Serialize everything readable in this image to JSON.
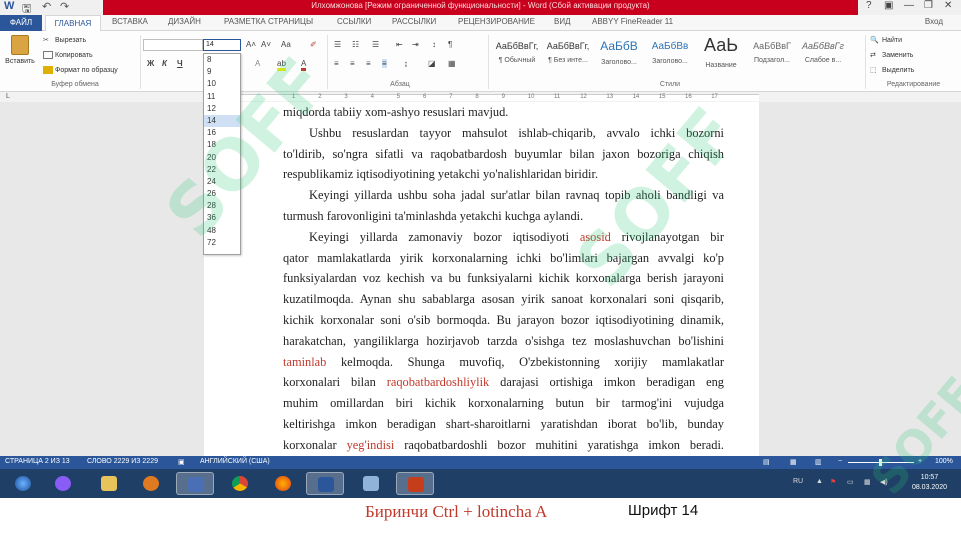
{
  "window": {
    "title": "Илхомжонова [Режим ограниченной функциональности] - Word (Сбой активации продукта)",
    "controls": [
      "?",
      "▣",
      "—",
      "❐",
      "✕"
    ]
  },
  "quick_access": {
    "save_icon": "save-icon",
    "undo_icon": "undo-icon",
    "redo_icon": "redo-icon"
  },
  "tabs": [
    {
      "label": "ФАЙЛ"
    },
    {
      "label": "ГЛАВНАЯ"
    },
    {
      "label": "ВСТАВКА"
    },
    {
      "label": "ДИЗАЙН"
    },
    {
      "label": "РАЗМЕТКА СТРАНИЦЫ"
    },
    {
      "label": "ССЫЛКИ"
    },
    {
      "label": "РАССЫЛКИ"
    },
    {
      "label": "РЕЦЕНЗИРОВАНИЕ"
    },
    {
      "label": "ВИД"
    },
    {
      "label": "ABBYY FineReader 11"
    }
  ],
  "signin": "Вход",
  "ribbon": {
    "clipboard": {
      "paste": "Вставить",
      "cut": "Вырезать",
      "copy": "Копировать",
      "format_painter": "Формат по образцу",
      "group_label": "Буфер обмена"
    },
    "font": {
      "bold": "Ж",
      "italic": "К",
      "underline": "Ч",
      "grow": "A˄",
      "shrink": "A˅",
      "case": "Aa"
    },
    "paragraph_label": "Абзац",
    "styles": [
      {
        "sample": "АаБбВвГг,",
        "name": "¶ Обычный"
      },
      {
        "sample": "АаБбВвГг,",
        "name": "¶ Без инте..."
      },
      {
        "sample": "АаБбВ",
        "name": "Заголово..."
      },
      {
        "sample": "АаБбВв",
        "name": "Заголово..."
      },
      {
        "sample": "АаЬ",
        "name": "Название"
      },
      {
        "sample": "АаБбВвГ",
        "name": "Подзагол..."
      },
      {
        "sample": "АаБбВвГг",
        "name": "Слабое в..."
      }
    ],
    "styles_label": "Стили",
    "editing": {
      "find": "Найти",
      "replace": "Заменить",
      "select": "Выделить",
      "group_label": "Редактирование"
    }
  },
  "font_size_list": [
    "8",
    "9",
    "10",
    "11",
    "12",
    "14",
    "16",
    "18",
    "20",
    "22",
    "24",
    "26",
    "28",
    "36",
    "48",
    "72"
  ],
  "font_size_selected": "14",
  "ruler_numbers": [
    "1",
    "2",
    "3",
    "4",
    "5",
    "6",
    "7",
    "8",
    "9",
    "10",
    "11",
    "12",
    "13",
    "14",
    "15",
    "16",
    "17"
  ],
  "document": {
    "lines": [
      {
        "parts": [
          "miqdorda tabiiy xom-ashyo resuslari mavjud."
        ],
        "just": false,
        "indent": false
      },
      {
        "parts": [
          "Ushbu resuslardan tayyor mahsulot ishlab-chiqarib, avvalo ichki bozorni"
        ],
        "just": true,
        "indent": true
      },
      {
        "parts": [
          "to'ldirib, so'ngra sifatli va raqobatbardosh buyumlar bilan jaxon bozoriga chiqish"
        ],
        "just": true,
        "indent": false
      },
      {
        "parts": [
          "respublikamiz iqtisodiyotining yetakchi yo'nalishlaridan biridir."
        ],
        "just": false,
        "indent": false
      },
      {
        "parts": [
          "Keyingi yillarda ushbu soha jadal sur'atlar bilan ravnaq topib aholi bandligi va"
        ],
        "just": true,
        "indent": true
      },
      {
        "parts": [
          "turmush farovonligini ta'minlashda yetakchi kuchga aylandi."
        ],
        "just": false,
        "indent": false
      },
      {
        "parts": [
          "Keyingi yillarda zamonaviy bozor iqtisodiyoti ",
          {
            "err": "asosid"
          },
          " rivojlanayotgan bir"
        ],
        "just": true,
        "indent": true
      },
      {
        "parts": [
          "qator mamlakatlarda yirik korxonalarning ichki bo'limlari bajargan avvalgi ko'p"
        ],
        "just": true,
        "indent": false
      },
      {
        "parts": [
          "funksiyalardan voz kechish va bu funksiyalarni kichik korxonalarga berish jarayoni"
        ],
        "just": true,
        "indent": false
      },
      {
        "parts": [
          "kuzatilmoqda. Aynan shu sabablarga asosan yirik sanoat korxonalari soni qisqarib,"
        ],
        "just": true,
        "indent": false
      },
      {
        "parts": [
          "kichik korxonalar soni o'sib bormoqda. Bu jarayon bozor iqtisodiyotining dinamik,"
        ],
        "just": true,
        "indent": false
      },
      {
        "parts": [
          "harakatchan, yangiliklarga hozirjavob tarzda o'sishga tez moslashuvchan bo'lishini"
        ],
        "just": true,
        "indent": false
      },
      {
        "parts": [
          {
            "err": "taminlab"
          },
          " kelmoqda. Shunga muvofiq, O'zbekistonning xorijiy mamlakatlar"
        ],
        "just": true,
        "indent": false
      },
      {
        "parts": [
          "korxonalari bilan ",
          {
            "err": "raqobatbardoshliylik"
          },
          " darajasi ortishiga imkon beradigan eng"
        ],
        "just": true,
        "indent": false
      },
      {
        "parts": [
          "muhim omillardan biri kichik korxonalarning butun bir tarmog'ini vujudga"
        ],
        "just": true,
        "indent": false
      },
      {
        "parts": [
          "keltirishga imkon beradigan shart-sharoitlarni yaratishdan iborat bo'lib, bunday"
        ],
        "just": true,
        "indent": false
      },
      {
        "parts": [
          "korxonalar ",
          {
            "err": "yeg'indisi"
          },
          " raqobatbardoshli bozor muhitini yaratishga imkon beradi."
        ],
        "just": true,
        "indent": false
      }
    ]
  },
  "statusbar": {
    "page": "СТРАНИЦА 2 ИЗ 13",
    "words": "СЛОВО 2229 ИЗ 2229",
    "language": "АНГЛИЙСКИЙ (США)",
    "zoom": "100%"
  },
  "taskbar": {
    "apps": [
      "start-orb-icon",
      "alice-icon",
      "folder-icon",
      "media-player-icon",
      "floppy-icon",
      "chrome-icon",
      "firefox-icon",
      "word-icon",
      "scanner-icon",
      "powerpoint-icon"
    ],
    "active_app": "word-icon",
    "lang": "RU",
    "time": "10:57",
    "date": "08.03.2020"
  },
  "caption": {
    "left": "Биринчи Ctrl + lotincha A",
    "right": "Шрифт 14"
  },
  "watermark_text": "SOFF",
  "colors": {
    "accent": "#2b579a",
    "title_red": "#c8001e",
    "error_red": "#c0392b",
    "watermark": "#28c878"
  }
}
